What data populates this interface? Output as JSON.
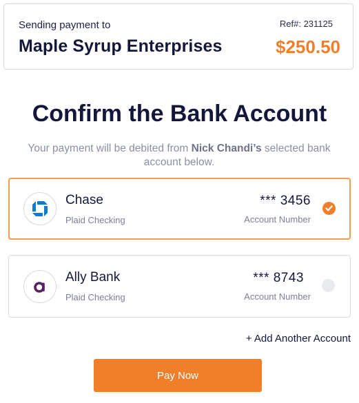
{
  "header": {
    "sending_label": "Sending payment to",
    "ref_label": "Ref#: 231125",
    "payee_name": "Maple Syrup Enterprises",
    "amount": "$250.50"
  },
  "main": {
    "title": "Confirm the Bank Account",
    "subtitle_prefix": "Your payment will be debited from ",
    "subtitle_name": "Nick Chandi’s",
    "subtitle_suffix": " selected bank account below."
  },
  "accounts": [
    {
      "bank_name": "Chase",
      "account_type": "Plaid Checking",
      "masked_number": "*** 3456",
      "number_caption": "Account Number",
      "selected": true,
      "logo_icon": "chase-logo-icon",
      "logo_color": "#117aca"
    },
    {
      "bank_name": "Ally Bank",
      "account_type": "Plaid Checking",
      "masked_number": "*** 8743",
      "number_caption": "Account Number",
      "selected": false,
      "logo_icon": "ally-logo-icon",
      "logo_color": "#5b1f66"
    }
  ],
  "add_account_label": "+ Add Another Account",
  "pay_button_label": "Pay Now",
  "colors": {
    "accent": "#f07f2c",
    "title": "#14173a",
    "muted": "#8a8fa3"
  }
}
